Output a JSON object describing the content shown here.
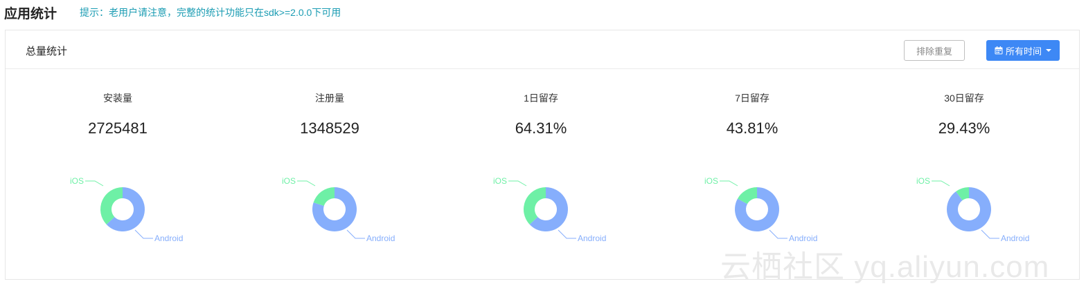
{
  "header": {
    "title": "应用统计",
    "notice": "提示：老用户请注意，完整的统计功能只在sdk>=2.0.0下可用"
  },
  "panel": {
    "title": "总量统计",
    "dedupe_button": "排除重复",
    "time_button": "所有时间"
  },
  "stats": [
    {
      "label": "安装量",
      "value": "2725481",
      "ios_fraction": 0.37
    },
    {
      "label": "注册量",
      "value": "1348529",
      "ios_fraction": 0.2
    },
    {
      "label": "1日留存",
      "value": "64.31%",
      "ios_fraction": 0.37
    },
    {
      "label": "7日留存",
      "value": "43.81%",
      "ios_fraction": 0.17
    },
    {
      "label": "30日留存",
      "value": "29.43%",
      "ios_fraction": 0.1
    }
  ],
  "legend": {
    "ios": "iOS",
    "android": "Android"
  },
  "colors": {
    "ios": "#6ef0a6",
    "android": "#86aefc",
    "accent": "#3d88f5",
    "notice": "#1b9cb3"
  },
  "watermark": "云栖社区 yq.aliyun.com"
}
